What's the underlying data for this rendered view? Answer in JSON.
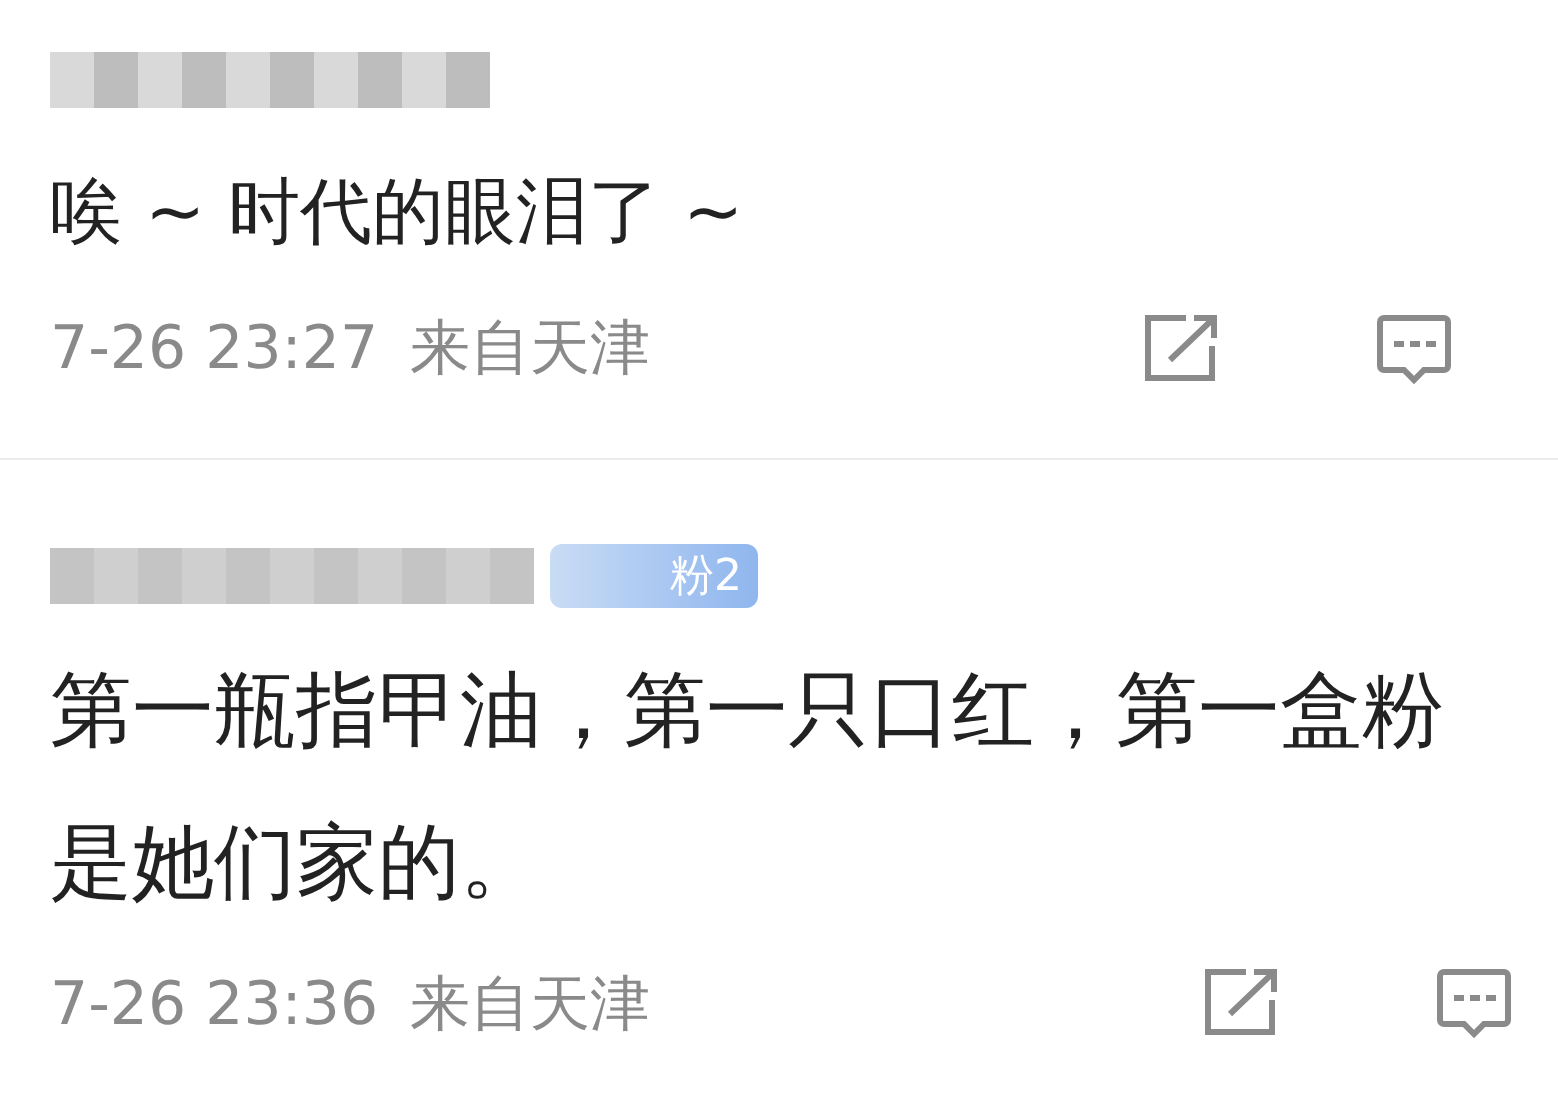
{
  "comments": [
    {
      "text": "唉 ~ 时代的眼泪了 ~",
      "time": "7-26 23:27",
      "location": "来自天津"
    },
    {
      "badge": "粉2",
      "text": "第一瓶指甲油，第一只口红，第一盒粉是她们家的。",
      "time": "7-26 23:36",
      "location": "来自天津"
    }
  ]
}
